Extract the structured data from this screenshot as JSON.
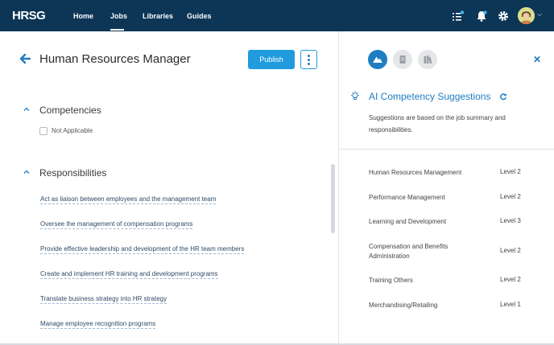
{
  "app": {
    "logo": "HRSG",
    "brand_color": "#0c3556",
    "accent_color": "#1f9bde"
  },
  "nav": {
    "items": [
      {
        "label": "Home",
        "active": false
      },
      {
        "label": "Jobs",
        "active": true
      },
      {
        "label": "Libraries",
        "active": false
      },
      {
        "label": "Guides",
        "active": false
      }
    ],
    "icons": [
      "tasks-icon",
      "bell-icon",
      "gear-icon",
      "avatar",
      "chevron-down-icon"
    ]
  },
  "job": {
    "title": "Human Resources Manager",
    "publish_label": "Publish",
    "competencies": {
      "title": "Competencies",
      "not_applicable_label": "Not Applicable",
      "not_applicable_checked": false
    },
    "responsibilities": {
      "title": "Responsibilities",
      "items": [
        "Act as liaison between employees and the management team",
        "Oversee the management of compensation programs",
        "Provide effective leadership and development of the HR team members",
        "Create and implement HR training and development programs",
        "Translate business strategy into HR strategy",
        "Manage employee recognition programs"
      ]
    }
  },
  "ai_panel": {
    "title": "AI Competency Suggestions",
    "description": "Suggestions are based on the job summary and responsibilities.",
    "suggestions": [
      {
        "name": "Human Resources Management",
        "level": "Level 2"
      },
      {
        "name": "Performance Management",
        "level": "Level 2"
      },
      {
        "name": "Learning and Development",
        "level": "Level 3"
      },
      {
        "name": "Compensation and Benefits Administration",
        "level": "Level 2"
      },
      {
        "name": "Training Others",
        "level": "Level 2"
      },
      {
        "name": "Merchandising/Retailing",
        "level": "Level 1"
      }
    ]
  }
}
